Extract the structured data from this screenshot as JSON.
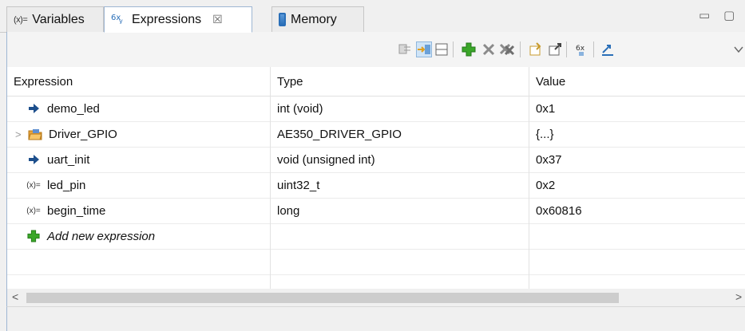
{
  "tabs": {
    "variables": "Variables",
    "expressions": "Expressions",
    "memory": "Memory",
    "variables_prefix": "(x)=",
    "close_glyph": "☒"
  },
  "window_controls": {
    "minimize": "▭",
    "maximize": "▢"
  },
  "toolbar": {
    "icons": [
      "collapse-all-icon",
      "show-type-names-icon",
      "layout-icon",
      "add-expression-icon",
      "remove-expression-icon",
      "remove-all-expressions-icon",
      "import-icon",
      "export-icon",
      "watch-icon",
      "open-view-icon",
      "view-menu-icon"
    ]
  },
  "table": {
    "columns": [
      "Expression",
      "Type",
      "Value"
    ],
    "rows": [
      {
        "icon": "arrow-right-icon",
        "expression": "demo_led",
        "type": "int (void)",
        "value": "0x1"
      },
      {
        "icon": "folder-icon",
        "expression": "Driver_GPIO",
        "type": "AE350_DRIVER_GPIO",
        "value": "{...}",
        "expandable": true
      },
      {
        "icon": "arrow-right-icon",
        "expression": "uart_init",
        "type": "void (unsigned int)",
        "value": "0x37"
      },
      {
        "icon": "variable-icon",
        "expression": "led_pin",
        "type": "uint32_t",
        "value": "0x2"
      },
      {
        "icon": "variable-icon",
        "expression": "begin_time",
        "type": "long",
        "value": "0x60816"
      }
    ],
    "add_new": "Add new expression",
    "expander_glyph": ">",
    "variable_prefix": "(x)="
  },
  "scrollbar": {
    "left": "<",
    "right": ">"
  },
  "colors": {
    "tab_border": "#9eb6d3",
    "add_green": "#3aa629",
    "arrow": "#1d4f8c"
  }
}
